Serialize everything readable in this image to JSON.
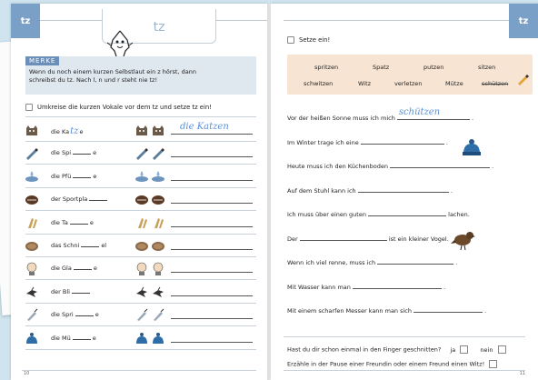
{
  "left": {
    "tag": "tz",
    "title": "tz",
    "merke": {
      "label": "MERKE",
      "line1": "Wenn du noch einem kurzen Selbstlaut ein z hörst, dann",
      "line2": "schreibst du tz. Nach l, n und r steht nie tz!"
    },
    "task": "Umkreise die kurzen Vokale vor dem tz und setze tz ein!",
    "rows": [
      {
        "pre": "die Ka",
        "hand_in": "tz",
        "post": "e",
        "hand_line": "die Katzen",
        "icon": "cat-icon"
      },
      {
        "pre": "die Spi",
        "post": "e",
        "icon": "pencil-icon"
      },
      {
        "pre": "die Pfü",
        "post": "e",
        "icon": "puddle-icon"
      },
      {
        "pre": "der Sportpla",
        "post": "",
        "icon": "ball-icon"
      },
      {
        "pre": "die Ta",
        "post": "e",
        "icon": "paw-icon"
      },
      {
        "pre": "das Schni",
        "post": "el",
        "icon": "schnitzel-icon"
      },
      {
        "pre": "die Gla",
        "post": "e",
        "icon": "head-icon"
      },
      {
        "pre": "der Bli",
        "post": "",
        "icon": "lightning-icon"
      },
      {
        "pre": "die Spri",
        "post": "e",
        "icon": "syringe-icon"
      },
      {
        "pre": "die Mü",
        "post": "e",
        "icon": "hat-icon"
      }
    ],
    "page_number": "10"
  },
  "right": {
    "tag": "tz",
    "task": "Setze ein!",
    "words_row1": [
      "spritzen",
      "Spatz",
      "putzen",
      "sitzen"
    ],
    "words_row2": [
      "schwitzen",
      "Witz",
      "verletzen",
      "Mütze",
      "schützen"
    ],
    "sentences": [
      {
        "pre": "Vor der heißen Sonne muss ich mich",
        "hand": "schützen",
        "post": "."
      },
      {
        "pre": "Im Winter trage ich eine",
        "post": "."
      },
      {
        "pre": "Heute muss ich den Küchenboden",
        "post": "."
      },
      {
        "pre": "Auf dem Stuhl kann ich",
        "post": "."
      },
      {
        "pre": "Ich muss über einen guten",
        "post": "lachen."
      },
      {
        "pre": "Der",
        "post": "ist ein kleiner Vogel."
      },
      {
        "pre": "Wenn ich viel renne, muss ich",
        "post": "."
      },
      {
        "pre": "Mit Wasser kann man",
        "post": "."
      },
      {
        "pre": "Mit einem scharfen Messer kann man sich",
        "post": "."
      }
    ],
    "question1": "Hast du dir schon einmal in den Finger geschnitten?",
    "ja": "ja",
    "nein": "nein",
    "question2": "Erzähle in der Pause einer Freundin oder einem Freund einen Witz!",
    "page_number": "11"
  },
  "colors": {
    "tag": "#7ba0c8",
    "merke_bg": "#dfe7ef",
    "wordbox_bg": "#f8e4d2",
    "handwriting": "#5b8fd6"
  }
}
